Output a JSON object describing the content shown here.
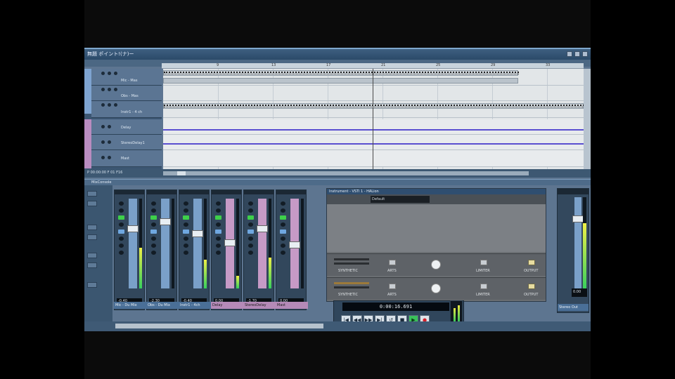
{
  "window": {
    "title": "無題 ポイント!(ナ)ー"
  },
  "ruler": {
    "marks": [
      "9",
      "13",
      "17",
      "21",
      "25",
      "29",
      "33"
    ]
  },
  "tracks": [
    {
      "name": "Mic - Mas"
    },
    {
      "name": "Obs - Mas"
    },
    {
      "name": "Instr1 - 4 ch"
    },
    {
      "name": "Delay"
    },
    {
      "name": "StereoDelay1"
    },
    {
      "name": "Mast"
    }
  ],
  "project_footer": {
    "zoom_text": "P 00:00:00   F 01  F16"
  },
  "mixer": {
    "title": "MixConsole",
    "channels": [
      {
        "name": "Mic - Du Mix",
        "readout": "-0.40",
        "level": 0.45,
        "fader": 0.3,
        "color": "blue"
      },
      {
        "name": "Obs - Du Mix",
        "readout": "-2.30",
        "level": 0.0,
        "fader": 0.22,
        "color": "blue"
      },
      {
        "name": "Instr1 - 4ch",
        "readout": "-0.40",
        "level": 0.32,
        "fader": 0.35,
        "color": "blue"
      },
      {
        "name": "Delay",
        "readout": "0.00",
        "level": 0.14,
        "fader": 0.45,
        "color": "pink"
      },
      {
        "name": "StereoDelay",
        "readout": "-1.70",
        "level": 0.34,
        "fader": 0.3,
        "color": "pink"
      },
      {
        "name": "Mast",
        "readout": "0.00",
        "level": 0.0,
        "fader": 0.48,
        "color": "pink"
      }
    ]
  },
  "rack": {
    "title": "Instrument - VSTi 1 - HALion",
    "preset": "Default",
    "slots": [
      {
        "name": "SYNTHETIC",
        "labels": [
          "ARTS",
          "LIMITER",
          "OUTPUT"
        ]
      },
      {
        "name": "SYNTHETIC",
        "labels": [
          "ARTS",
          "LIMITER",
          "OUTPUT"
        ]
      }
    ]
  },
  "transport": {
    "time": "0:00:16.691",
    "buttons": [
      "|◀",
      "◀◀",
      "▶▶",
      "▶|",
      "↺",
      "■",
      "▶",
      "●"
    ]
  },
  "master": {
    "name": "Stereo Out",
    "readout": "0.00",
    "level": 0.72
  },
  "colors": {
    "panel": "#5d7590",
    "fader_blue": "#7aa0c9",
    "fader_pink": "#c69ac6",
    "play_green": "#39c15a",
    "record_red": "#d4202a"
  }
}
